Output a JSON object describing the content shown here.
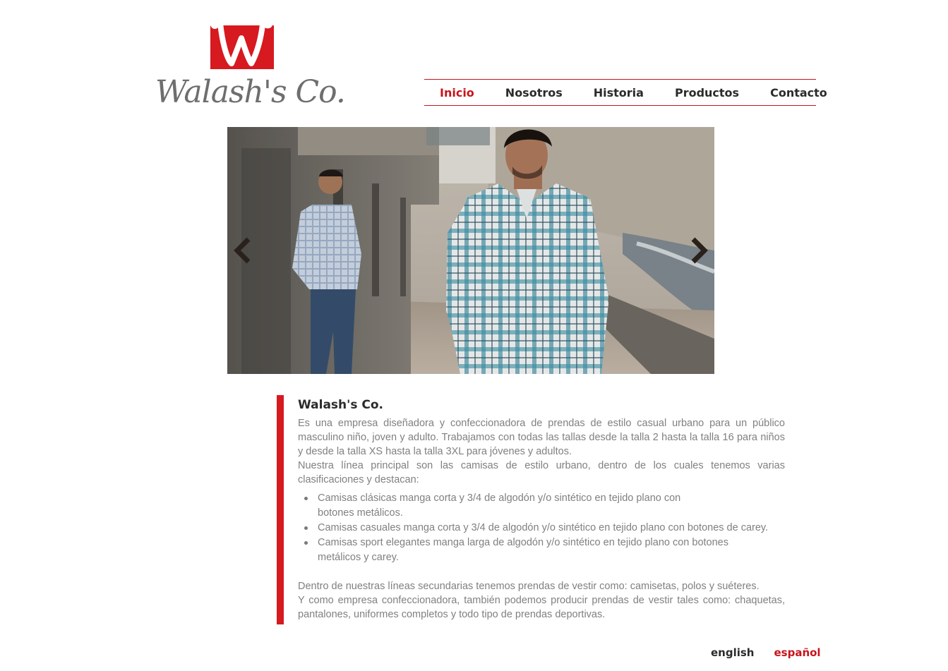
{
  "brand": {
    "name": "Walash's Co.",
    "accent_color": "#d71920",
    "logo_icon": "w-monogram-icon"
  },
  "nav": {
    "items": [
      {
        "label": "Inicio",
        "active": true
      },
      {
        "label": "Nosotros",
        "active": false
      },
      {
        "label": "Historia",
        "active": false
      },
      {
        "label": "Productos",
        "active": false
      },
      {
        "label": "Contacto",
        "active": false
      }
    ]
  },
  "slider": {
    "prev_icon": "chevron-left-icon",
    "next_icon": "chevron-right-icon"
  },
  "content": {
    "title": "Walash's Co.",
    "paragraph1": "Es una empresa diseñadora y confeccionadora de prendas de estilo casual urbano para un público masculino niño, joven y adulto. Trabajamos con todas las tallas desde la talla 2 hasta la talla 16 para niños y desde la talla XS hasta la talla 3XL para jóvenes y adultos.",
    "paragraph2": "Nuestra línea principal son las camisas de estilo urbano, dentro de los cuales tenemos varias clasificaciones y destacan:",
    "list": [
      "Camisas clásicas manga corta y 3/4 de algodón y/o sintético en tejido plano con botones metálicos.",
      "Camisas casuales manga corta y 3/4 de algodón y/o sintético en tejido plano con botones de carey.",
      "Camisas sport elegantes manga larga de algodón y/o sintético en tejido plano con botones metálicos y carey."
    ],
    "paragraph3": "Dentro de nuestras líneas secundarias tenemos prendas de vestir como: camisetas, polos y suéteres.",
    "paragraph4": "Y como empresa confeccionadora, también podemos producir prendas de vestir tales como: chaquetas, pantalones, uniformes completos y todo tipo de prendas deportivas."
  },
  "language": {
    "english": "english",
    "spanish": "español",
    "active": "español"
  }
}
